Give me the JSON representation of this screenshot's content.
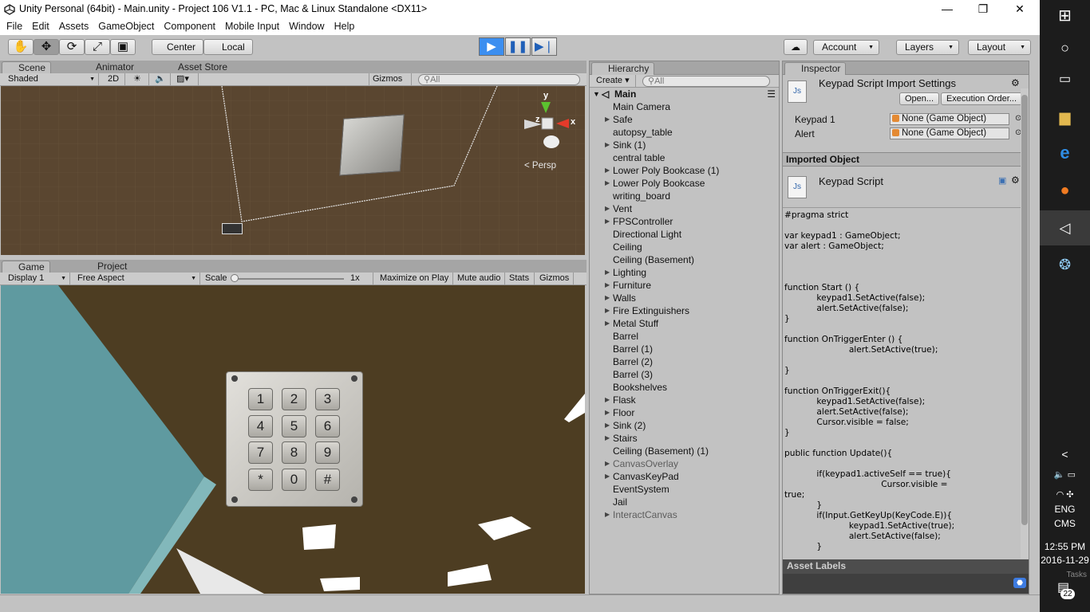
{
  "window": {
    "title": "Unity Personal (64bit) - Main.unity - Project 106 V1.1 - PC, Mac & Linux Standalone <DX11>"
  },
  "menu": [
    "File",
    "Edit",
    "Assets",
    "GameObject",
    "Component",
    "Mobile Input",
    "Window",
    "Help"
  ],
  "toolbar": {
    "pivot": "Center",
    "space": "Local",
    "account": "Account",
    "layers": "Layers",
    "layout": "Layout"
  },
  "scene": {
    "tabs": [
      "Scene",
      "Animator",
      "Asset Store"
    ],
    "shading": "Shaded",
    "mode_2d": "2D",
    "gizmos": "Gizmos",
    "search_placeholder": "All",
    "persp": "Persp",
    "axis_y": "y",
    "axis_x": "x",
    "axis_z": "z"
  },
  "game": {
    "tabs": [
      "Game",
      "Project"
    ],
    "display": "Display 1",
    "aspect": "Free Aspect",
    "scale_label": "Scale",
    "scale_value": "1x",
    "maximize": "Maximize on Play",
    "mute": "Mute audio",
    "stats": "Stats",
    "gizmos": "Gizmos",
    "keypad_keys": [
      "1",
      "2",
      "3",
      "4",
      "5",
      "6",
      "7",
      "8",
      "9",
      "*",
      "0",
      "#"
    ]
  },
  "hierarchy": {
    "tab": "Hierarchy",
    "create": "Create",
    "search_placeholder": "All",
    "scene_name": "Main",
    "items": [
      {
        "label": "Main Camera",
        "expandable": false,
        "dim": false
      },
      {
        "label": "Safe",
        "expandable": true,
        "dim": false
      },
      {
        "label": "autopsy_table",
        "expandable": false,
        "dim": false
      },
      {
        "label": "Sink (1)",
        "expandable": true,
        "dim": false
      },
      {
        "label": "central table",
        "expandable": false,
        "dim": false
      },
      {
        "label": "Lower Poly Bookcase (1)",
        "expandable": true,
        "dim": false
      },
      {
        "label": "Lower Poly Bookcase",
        "expandable": true,
        "dim": false
      },
      {
        "label": "writing_board",
        "expandable": false,
        "dim": false
      },
      {
        "label": "Vent",
        "expandable": true,
        "dim": false
      },
      {
        "label": "FPSController",
        "expandable": true,
        "dim": false
      },
      {
        "label": "Directional Light",
        "expandable": false,
        "dim": false
      },
      {
        "label": "Ceiling",
        "expandable": false,
        "dim": false
      },
      {
        "label": "Ceiling (Basement)",
        "expandable": false,
        "dim": false
      },
      {
        "label": "Lighting",
        "expandable": true,
        "dim": false
      },
      {
        "label": "Furniture",
        "expandable": true,
        "dim": false
      },
      {
        "label": "Walls",
        "expandable": true,
        "dim": false
      },
      {
        "label": "Fire Extinguishers",
        "expandable": true,
        "dim": false
      },
      {
        "label": "Metal Stuff",
        "expandable": true,
        "dim": false
      },
      {
        "label": "Barrel",
        "expandable": false,
        "dim": false
      },
      {
        "label": "Barrel (1)",
        "expandable": false,
        "dim": false
      },
      {
        "label": "Barrel (2)",
        "expandable": false,
        "dim": false
      },
      {
        "label": "Barrel (3)",
        "expandable": false,
        "dim": false
      },
      {
        "label": "Bookshelves",
        "expandable": false,
        "dim": false
      },
      {
        "label": "Flask",
        "expandable": true,
        "dim": false
      },
      {
        "label": "Floor",
        "expandable": true,
        "dim": false
      },
      {
        "label": "Sink (2)",
        "expandable": true,
        "dim": false
      },
      {
        "label": "Stairs",
        "expandable": true,
        "dim": false
      },
      {
        "label": "Ceiling (Basement) (1)",
        "expandable": false,
        "dim": false
      },
      {
        "label": "CanvasOverlay",
        "expandable": true,
        "dim": true
      },
      {
        "label": "CanvasKeyPad",
        "expandable": true,
        "dim": false
      },
      {
        "label": "EventSystem",
        "expandable": false,
        "dim": false
      },
      {
        "label": "Jail",
        "expandable": false,
        "dim": false
      },
      {
        "label": "InteractCanvas",
        "expandable": true,
        "dim": true
      }
    ]
  },
  "inspector": {
    "tab": "Inspector",
    "title": "Keypad Script Import Settings",
    "open": "Open...",
    "exec_order": "Execution Order...",
    "js_icon": "Js",
    "fields": [
      {
        "label": "Keypad 1",
        "value": "None (Game Object)"
      },
      {
        "label": "Alert",
        "value": "None (Game Object)"
      }
    ],
    "imported_header": "Imported Object",
    "script_name": "Keypad Script",
    "code": "#pragma strict\n\nvar keypad1 : GameObject;\nvar alert : GameObject;\n\n\n\nfunction Start () {\n            keypad1.SetActive(false);\n            alert.SetActive(false);\n}\n\nfunction OnTriggerEnter () {\n                        alert.SetActive(true);\n\n}\n\nfunction OnTriggerExit(){\n            keypad1.SetActive(false);\n            alert.SetActive(false);\n            Cursor.visible = false;\n}\n\npublic function Update(){\n\n            if(keypad1.activeSelf == true){\n                                    Cursor.visible =\ntrue;\n            }\n            if(Input.GetKeyUp(KeyCode.E)){\n                        keypad1.SetActive(true);\n                        alert.SetActive(false);\n            }",
    "asset_labels": "Asset Labels"
  },
  "taskbar": {
    "time": "12:55 PM",
    "date": "2016-11-29",
    "lang1": "ENG",
    "lang2": "CMS",
    "notifications": "22",
    "tasks": "Tasks"
  },
  "colors": {
    "play_active": "#3b8ef0",
    "unity_bg": "#c2c2c2",
    "taskbar": "#1c1c1c"
  }
}
